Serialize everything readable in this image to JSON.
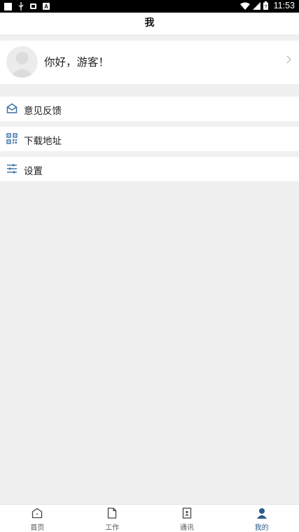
{
  "status_bar": {
    "time": "11:53",
    "icons": [
      "square-notification-icon",
      "usb-icon",
      "sim-icon",
      "a-notification-icon",
      "wifi-icon",
      "signal-icon",
      "battery-icon"
    ]
  },
  "header": {
    "title": "我"
  },
  "profile": {
    "greeting": "你好，游客！",
    "icons": [
      "avatar-placeholder",
      "chevron-right-icon"
    ]
  },
  "menu": [
    {
      "label": "意见反馈",
      "icon": "envelope-icon"
    },
    {
      "label": "下载地址",
      "icon": "qr-code-icon"
    },
    {
      "label": "设置",
      "icon": "sliders-icon"
    }
  ],
  "tabs": [
    {
      "label": "首页",
      "icon": "home-icon",
      "active": false
    },
    {
      "label": "工作",
      "icon": "document-icon",
      "active": false
    },
    {
      "label": "通讯",
      "icon": "contacts-icon",
      "active": false
    },
    {
      "label": "我的",
      "icon": "person-icon",
      "active": true
    }
  ],
  "colors": {
    "accent": "#2b5c8a",
    "icon_blue": "#3a6fa5",
    "background": "#f0f0f0"
  }
}
